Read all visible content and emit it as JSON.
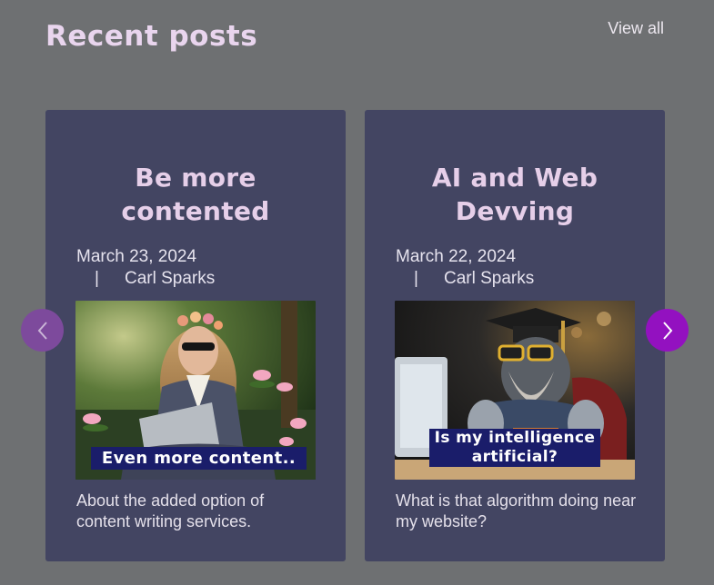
{
  "header": {
    "title": "Recent posts",
    "view_all_label": "View all"
  },
  "posts": [
    {
      "title": "Be more contented",
      "date": "March 23, 2024",
      "separator": "|",
      "author": "Carl Sparks",
      "image_caption": "Even more content..",
      "excerpt": "About the added option of content writing services."
    },
    {
      "title": "AI and Web Devving",
      "date": "March 22, 2024",
      "separator": "|",
      "author": "Carl Sparks",
      "image_caption": "Is my intelligence artificial?",
      "excerpt": "What is that algorithm doing near my website?"
    }
  ],
  "carousel": {
    "prev_icon": "chevron-left-icon",
    "next_icon": "chevron-right-icon",
    "prev_color": "#7d4a9c",
    "next_color": "#9311c0"
  },
  "colors": {
    "background": "#6e7072",
    "card": "#434562",
    "title": "#e9d5ee",
    "caption_bg": "#1a1d6a"
  }
}
